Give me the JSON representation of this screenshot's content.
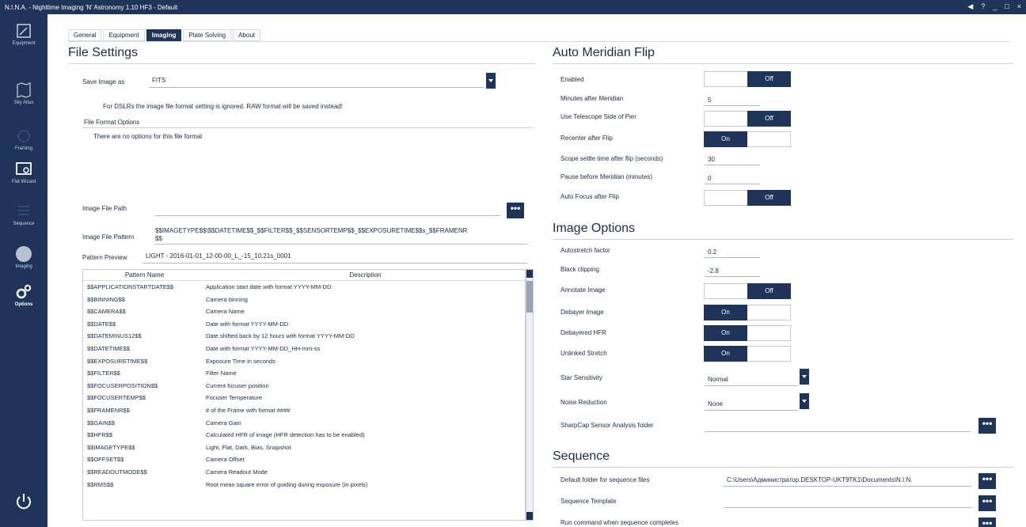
{
  "window": {
    "title": "N.I.N.A. - Nighttime Imaging 'N' Astronomy 1.10 HF3 - Default",
    "controls": [
      "◀",
      "?",
      "_",
      "□",
      "×"
    ]
  },
  "sidebar": {
    "items": [
      {
        "label": "Equipment",
        "icon": "equipment-icon"
      },
      {
        "label": "Sky Atlas",
        "icon": "sky-atlas-icon"
      },
      {
        "label": "Framing",
        "icon": "framing-icon"
      },
      {
        "label": "Flat Wizard",
        "icon": "flat-wizard-icon"
      },
      {
        "label": "Sequence",
        "icon": "sequence-icon"
      },
      {
        "label": "Imaging",
        "icon": "imaging-icon"
      },
      {
        "label": "Options",
        "icon": "gears-icon"
      }
    ],
    "power_icon": "power-icon"
  },
  "tabs": [
    "General",
    "Equipment",
    "Imaging",
    "Plate Solving",
    "About"
  ],
  "file_settings": {
    "heading": "File Settings",
    "save_image_as_label": "Save Image as",
    "save_image_as_value": "FITS",
    "dslr_note": "For DSLRs the image file format setting is ignored. RAW format will be saved instead!",
    "file_format_options_label": "File Format Options",
    "no_options_text": "There are no options for this file format",
    "image_file_path_label": "Image File Path",
    "image_file_path_value": "",
    "image_file_pattern_label": "Image File Pattern",
    "image_file_pattern_value_1": "$$IMAGETYPE$$\\$$DATETIME$$_$$FILTER$$_$$SENSORTEMP$$_$$EXPOSURETIME$$s_$$FRAMENR",
    "image_file_pattern_value_2": "$$",
    "pattern_preview_label": "Pattern Preview",
    "pattern_preview_value": "LIGHT - 2016-01-01_12-00-00_L_-15_10.21s_0001",
    "table": {
      "headers": [
        "Pattern Name",
        "Description"
      ],
      "rows": [
        [
          "$$APPLICATIONSTARTDATE$$",
          "Application start date with format YYYY-MM-DD"
        ],
        [
          "$$BINNING$$",
          "Camera binning"
        ],
        [
          "$$CAMERA$$",
          "Camera Name"
        ],
        [
          "$$DATE$$",
          "Date with format YYYY-MM-DD"
        ],
        [
          "$$DATEMINUS12$$",
          "Date shifted back by 12 hours with format YYYY-MM-DD"
        ],
        [
          "$$DATETIME$$",
          "Date with format YYYY-MM-DD_HH-mm-ss"
        ],
        [
          "$$EXPOSURETIME$$",
          "Exposure Time in seconds"
        ],
        [
          "$$FILTER$$",
          "Filter Name"
        ],
        [
          "$$FOCUSERPOSITION$$",
          "Current focuser position"
        ],
        [
          "$$FOCUSERTEMP$$",
          "Focuser Temperature"
        ],
        [
          "$$FRAMENR$$",
          "# of the Frame with format ####"
        ],
        [
          "$$GAIN$$",
          "Camera Gain"
        ],
        [
          "$$HFR$$",
          "Calculated HFR of image (HFR detection has to be enabled)"
        ],
        [
          "$$IMAGETYPE$$",
          "Light, Flat, Dark, Bias, Snapshot"
        ],
        [
          "$$OFFSET$$",
          "Camera Offset"
        ],
        [
          "$$READOUTMODE$$",
          "Camera Readout Mode"
        ],
        [
          "$$RMS$$",
          "Root mean square error of guiding during exposure (in pixels)"
        ]
      ]
    }
  },
  "meridian_flip": {
    "heading": "Auto Meridian Flip",
    "enabled_label": "Enabled",
    "enabled_state": "Off",
    "minutes_after_label": "Minutes after Meridian",
    "minutes_after_value": "5",
    "use_side_of_pier_label": "Use Telescope Side of Pier",
    "use_side_of_pier_state": "Off",
    "recenter_label": "Recenter after Flip",
    "recenter_state": "On",
    "settle_time_label": "Scope settle time after flip (seconds)",
    "settle_time_value": "30",
    "pause_before_label": "Pause before Meridian (minutes)",
    "pause_before_value": "0",
    "autofocus_label": "Auto Focus after Flip",
    "autofocus_state": "Off"
  },
  "image_options": {
    "heading": "Image Options",
    "autostretch_label": "Autostretch factor",
    "autostretch_value": "0.2",
    "black_clipping_label": "Black clipping",
    "black_clipping_value": "-2.8",
    "annotate_label": "Annotate Image",
    "annotate_state": "Off",
    "debayer_label": "Debayer Image",
    "debayer_state": "On",
    "debayered_hfr_label": "Debayered HFR",
    "debayered_hfr_state": "On",
    "unlinked_stretch_label": "Unlinked Stretch",
    "unlinked_stretch_state": "On",
    "star_sensitivity_label": "Star Sensitivity",
    "star_sensitivity_value": "Normal",
    "noise_reduction_label": "Noise Reduction",
    "noise_reduction_value": "None",
    "sharpcap_label": "SharpCap Sensor Analysis folder",
    "sharpcap_value": ""
  },
  "sequence": {
    "heading": "Sequence",
    "default_folder_label": "Default folder for sequence files",
    "default_folder_value": "C:\\Users\\Администратор.DESKTOP-UKT9TK1\\Documents\\N.I.N.",
    "template_label": "Sequence Template",
    "template_value": "",
    "run_command_label": "Run command when sequence completes"
  },
  "dots_label": "•••"
}
